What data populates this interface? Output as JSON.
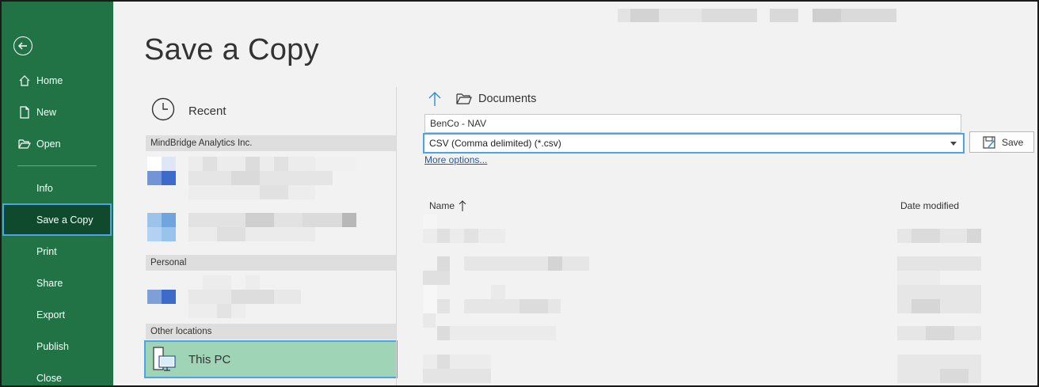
{
  "sidebar": {
    "items": [
      {
        "label": "Home",
        "icon": "home-icon"
      },
      {
        "label": "New",
        "icon": "new-document-icon"
      },
      {
        "label": "Open",
        "icon": "open-folder-icon"
      },
      {
        "label": "Info"
      },
      {
        "label": "Save a Copy",
        "selected": true
      },
      {
        "label": "Print"
      },
      {
        "label": "Share"
      },
      {
        "label": "Export"
      },
      {
        "label": "Publish"
      },
      {
        "label": "Close"
      }
    ]
  },
  "page": {
    "title": "Save a Copy"
  },
  "locations": {
    "recent_label": "Recent",
    "sections": [
      "MindBridge Analytics Inc.",
      "Personal",
      "Other locations"
    ],
    "this_pc_label": "This PC"
  },
  "save_panel": {
    "current_folder": "Documents",
    "filename": "BenCo - NAV",
    "file_type": "CSV (Comma delimited) (*.csv)",
    "save_label": "Save",
    "more_options": "More options...",
    "columns": {
      "name": "Name",
      "date": "Date modified"
    }
  },
  "colors": {
    "sidebar_bg": "#217346",
    "sidebar_selected": "#0e4a2b",
    "focus_border": "#4ea2ea",
    "this_pc_bg": "#9fd5b6",
    "link": "#2b579a"
  }
}
